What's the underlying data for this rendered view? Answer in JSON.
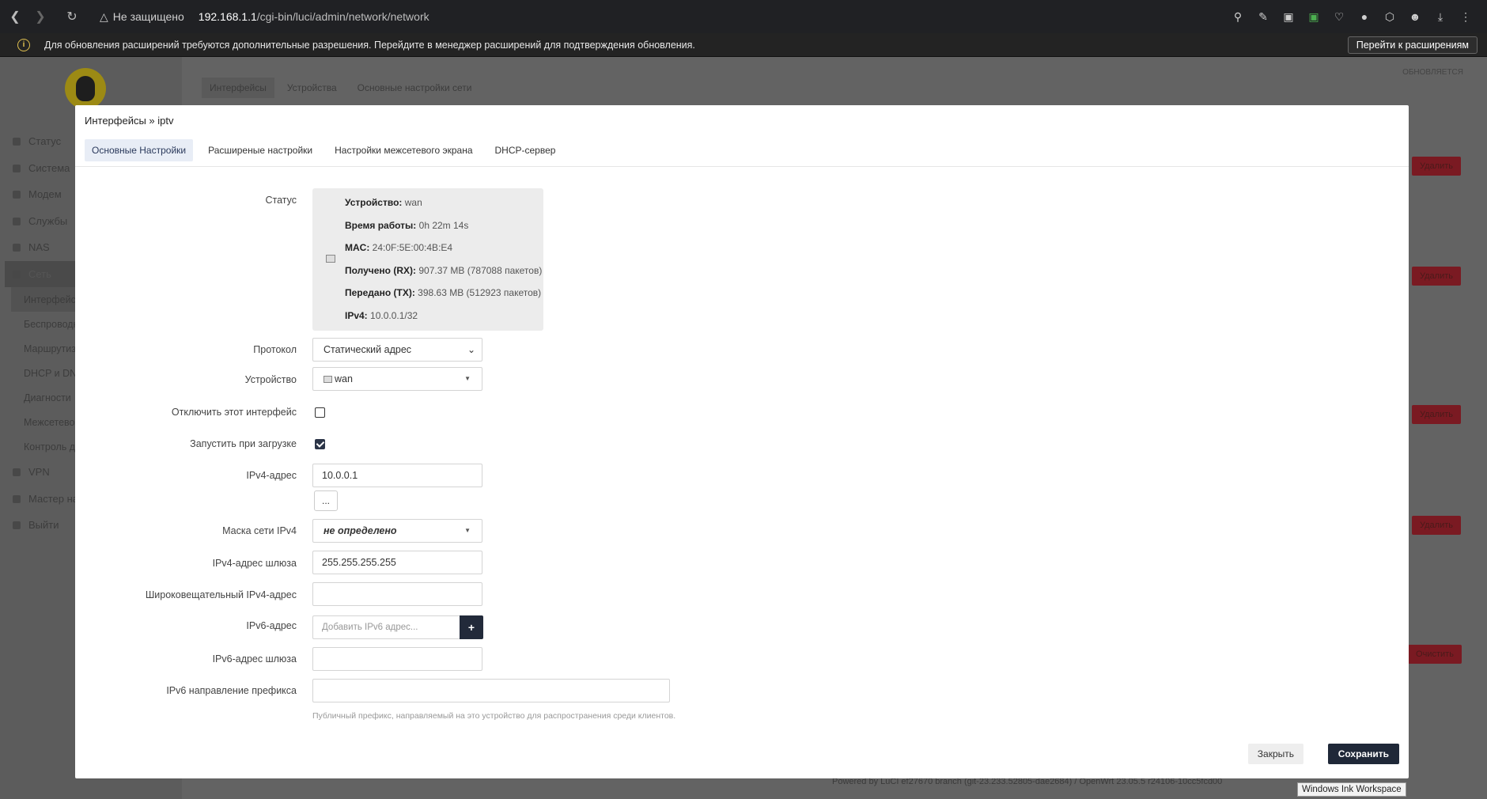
{
  "browser": {
    "security_label": "Не защищено",
    "url_host": "192.168.1.1",
    "url_path": "/cgi-bin/luci/admin/network/network",
    "infobar_text": "Для обновления расширений требуются дополнительные разрешения. Перейдите в менеджер расширений для подтверждения обновления.",
    "infobar_button": "Перейти к расширениям"
  },
  "background": {
    "menu": [
      "Статус",
      "Система",
      "Модем",
      "Службы",
      "NAS",
      "Сеть"
    ],
    "submenu": [
      "Интерфейсы",
      "Беспроводн",
      "Маршрутиз",
      "DHCP и DN",
      "Диагности",
      "Межсетево",
      "Контроль д"
    ],
    "menu_bottom": [
      "VPN",
      "Мастер на",
      "Выйти"
    ],
    "tabs": [
      "Интерфейсы",
      "Устройства",
      "Основные настройки сети"
    ],
    "updating": "ОБНОВЛЯЕТСЯ",
    "delete_label": "Удалить",
    "clear_label": "Очистить",
    "footer": "Powered by LuCI ef27670 branch (git-23.233.52805-dae2684) / OpenWrt 23.05.5 r24106-10cc5fcd00"
  },
  "modal": {
    "title": "Интерфейсы » iptv",
    "tabs": [
      "Основные Настройки",
      "Расширеные настройки",
      "Настройки межсетевого экрана",
      "DHCP-сервер"
    ],
    "status": {
      "label": "Статус",
      "device_key": "Устройство:",
      "device_val": "wan",
      "uptime_key": "Время работы:",
      "uptime_val": "0h 22m 14s",
      "mac_key": "MAC:",
      "mac_val": "24:0F:5E:00:4B:E4",
      "rx_key": "Получено (RX):",
      "rx_val": "907.37 MB (787088 пакетов)",
      "tx_key": "Передано (TX):",
      "tx_val": "398.63 MB (512923 пакетов)",
      "ipv4_key": "IPv4:",
      "ipv4_val": "10.0.0.1/32"
    },
    "fields": {
      "protocol_label": "Протокол",
      "protocol_value": "Статический адрес",
      "device_label": "Устройство",
      "device_value": "wan",
      "disable_label": "Отключить этот интерфейс",
      "autostart_label": "Запустить при загрузке",
      "ipv4_label": "IPv4-адрес",
      "ipv4_value": "10.0.0.1",
      "ipv4_more": "...",
      "netmask_label": "Маска сети IPv4",
      "netmask_value": "не определено",
      "gateway_label": "IPv4-адрес шлюза",
      "gateway_value": "255.255.255.255",
      "broadcast_label": "Широковещательный IPv4-адрес",
      "broadcast_value": "",
      "ipv6_label": "IPv6-адрес",
      "ipv6_placeholder": "Добавить IPv6 адрес...",
      "ipv6_add": "+",
      "ipv6_gw_label": "IPv6-адрес шлюза",
      "ipv6_gw_value": "",
      "prefix_label": "IPv6 направление префикса",
      "prefix_value": "",
      "prefix_hint": "Публичный префикс, направляемый на это устройство для распространения среди клиентов."
    },
    "checkbox_disable": false,
    "checkbox_autostart": true,
    "close_label": "Закрыть",
    "save_label": "Сохранить"
  },
  "tooltip": "Windows Ink Workspace"
}
